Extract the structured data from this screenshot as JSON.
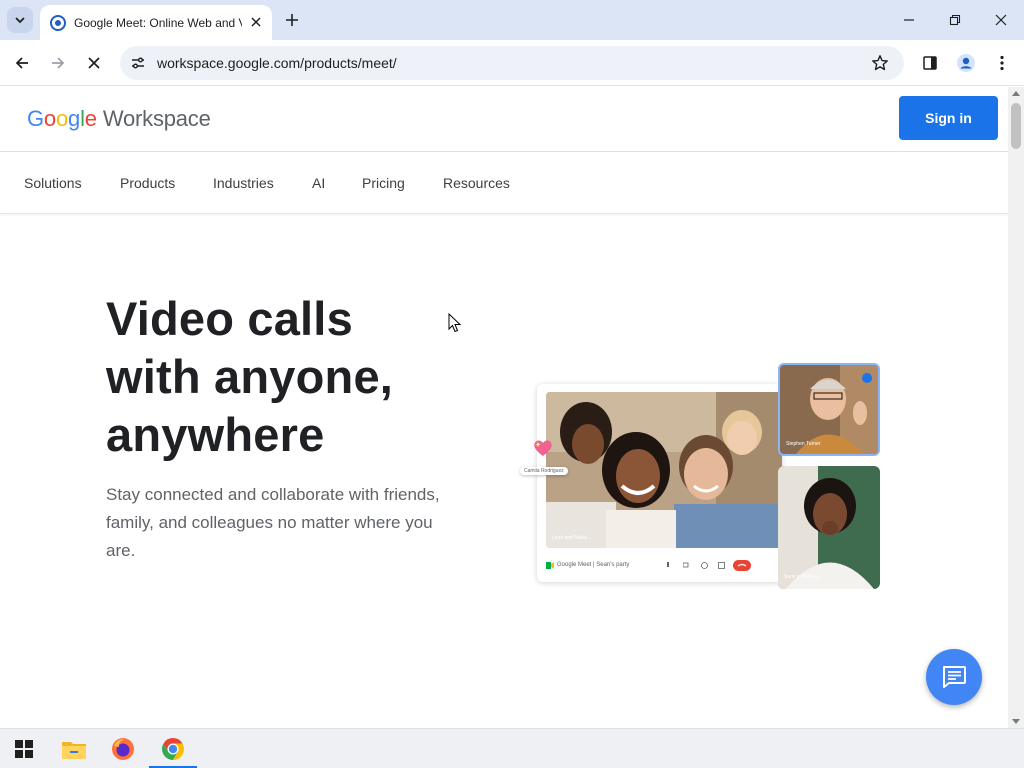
{
  "browser": {
    "tab_title": "Google Meet: Online Web and Video Conferencing Calls | Google Workspace",
    "url": "workspace.google.com/products/meet/"
  },
  "site": {
    "logo_google_letters": [
      "G",
      "o",
      "o",
      "g",
      "l",
      "e"
    ],
    "logo_product": "Workspace",
    "sign_in": "Sign in",
    "nav": [
      "Solutions",
      "Products",
      "Industries",
      "AI",
      "Pricing",
      "Resources"
    ]
  },
  "hero": {
    "title_lines": [
      "Video calls",
      "with anyone,",
      "anywhere"
    ],
    "subtitle": "Stay connected and collaborate with friends, family, and colleagues no matter where you are."
  },
  "illustration": {
    "chip_name": "Camila Rodriguez",
    "tile1_name": "Stephen Turner",
    "tile2_name": "Sumi in Ratnas...",
    "main_name": "Leah and Nakai...",
    "meet_bar_text": "Google Meet | Sean's party"
  },
  "colors": {
    "accent": "#1a73e8",
    "tabbar": "#dbe5f6",
    "chat_fab": "#4285f4"
  },
  "icons": {
    "tab_favicon": "google-meet-favicon",
    "chat": "chat-icon",
    "taskbar": [
      "windows-start-icon",
      "file-explorer-icon",
      "firefox-icon",
      "chrome-icon"
    ]
  }
}
